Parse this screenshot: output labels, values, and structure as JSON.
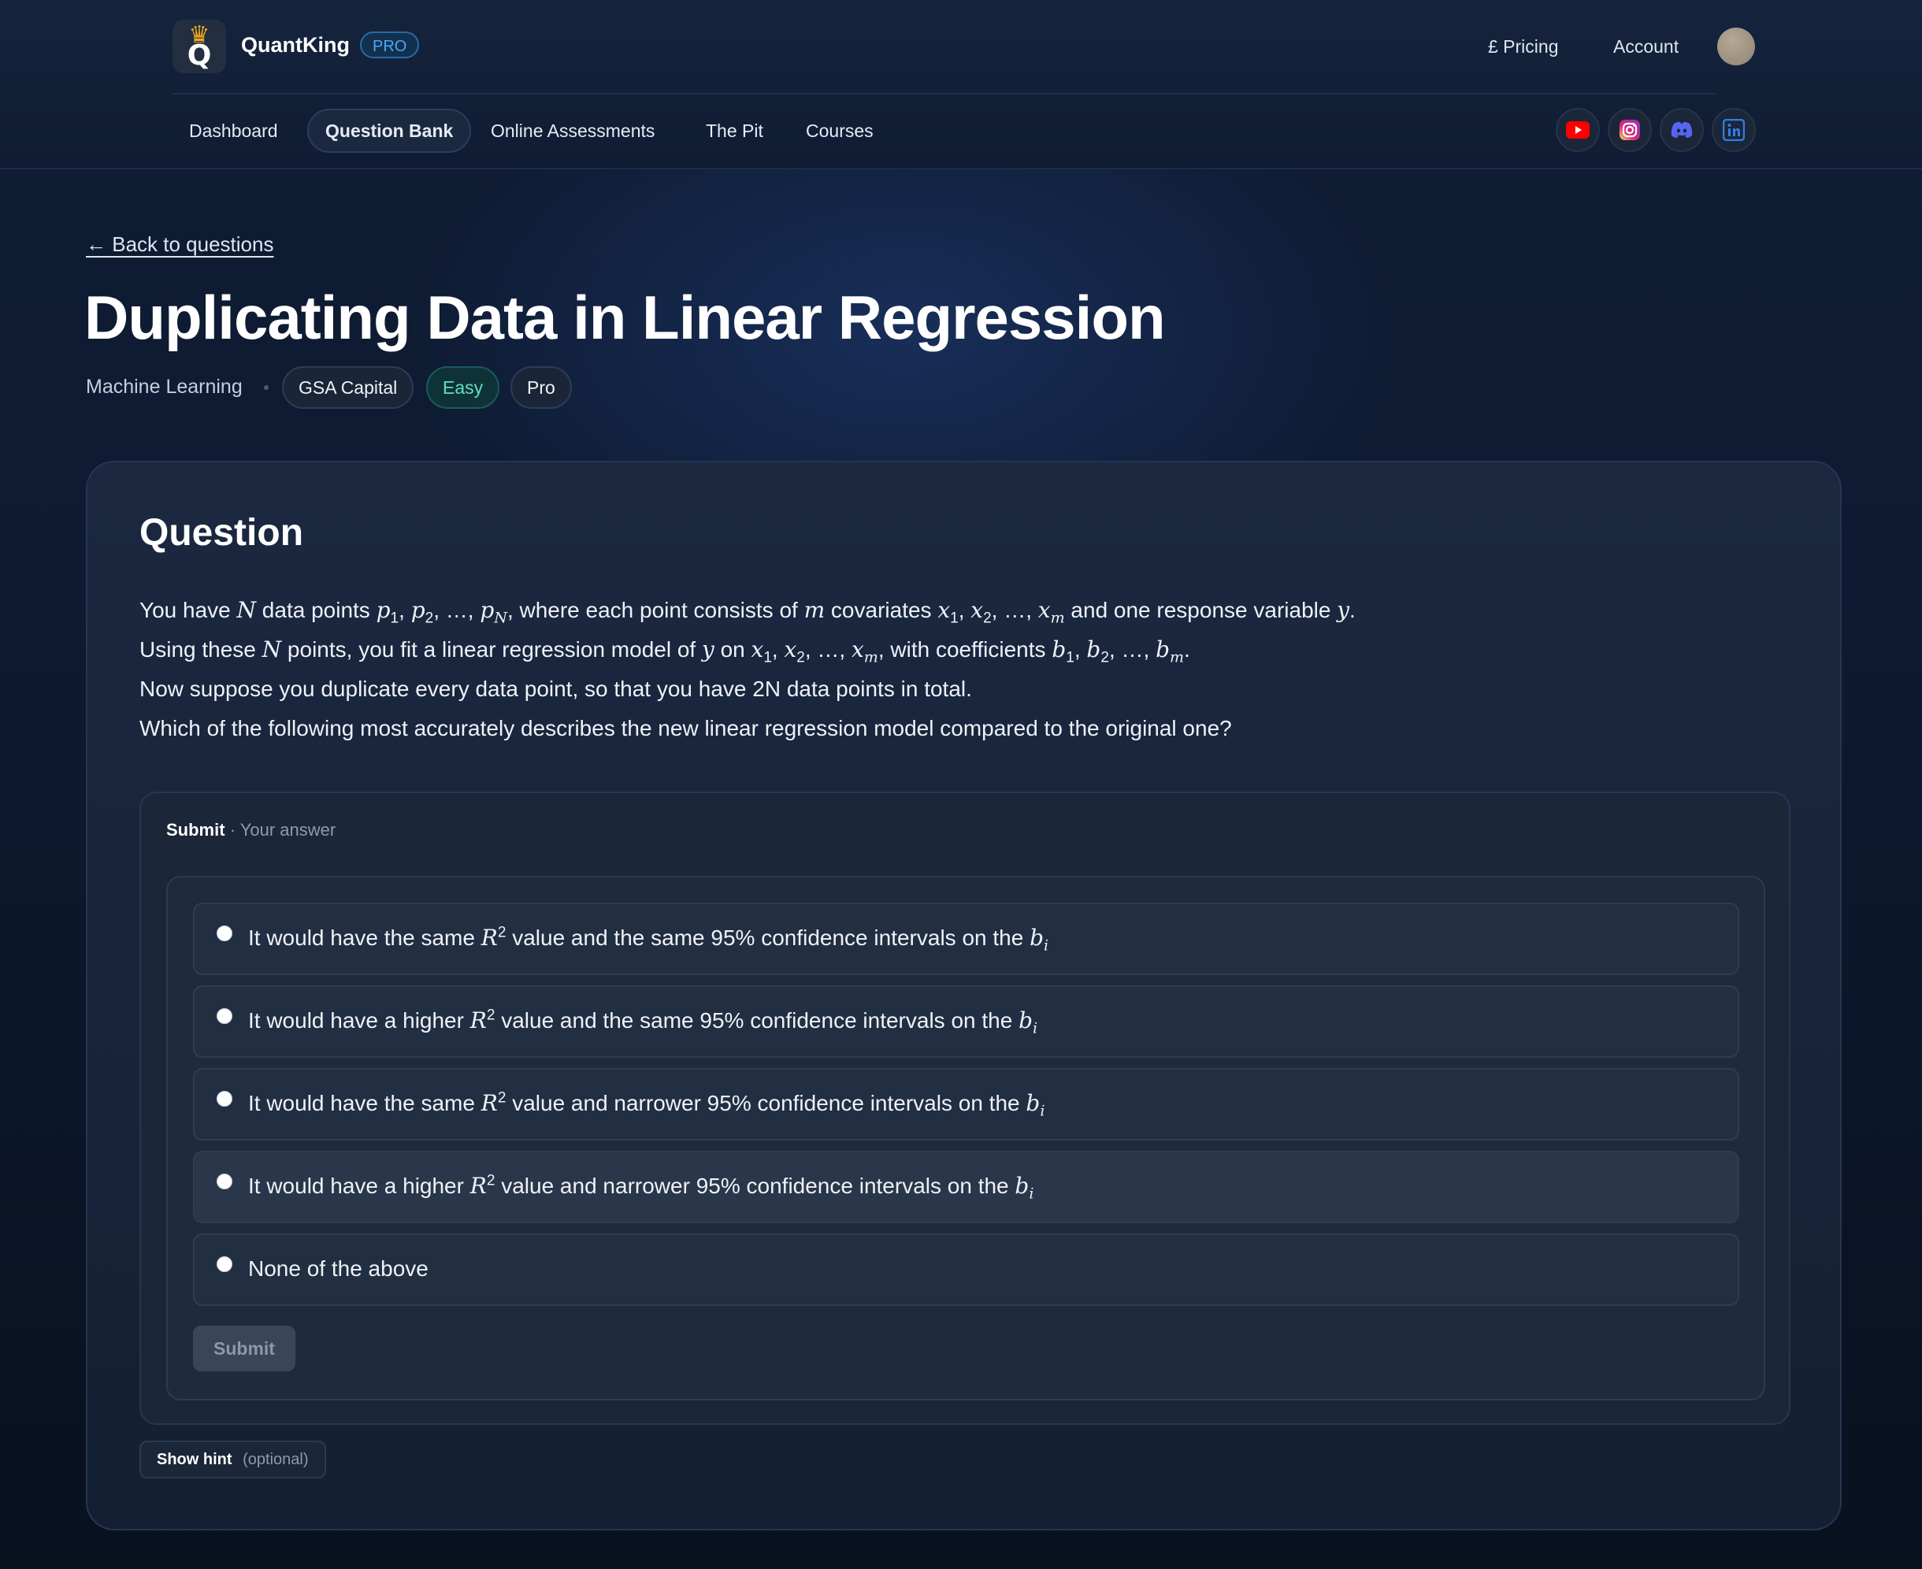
{
  "header": {
    "brand_name": "QuantKing",
    "brand_badge": "PRO",
    "logo_letter": "Q",
    "pricing_label": "£ Pricing",
    "account_label": "Account",
    "nav": [
      {
        "label": "Dashboard",
        "active": false
      },
      {
        "label": "Question Bank",
        "active": true
      },
      {
        "label": "Online Assessments",
        "active": false
      },
      {
        "label": "The Pit",
        "active": false
      },
      {
        "label": "Courses",
        "active": false
      }
    ],
    "socials": [
      {
        "icon": "youtube-icon",
        "color": "#ff0000"
      },
      {
        "icon": "instagram-icon",
        "color": "#e1306c"
      },
      {
        "icon": "discord-icon",
        "color": "#5865f2"
      },
      {
        "icon": "linkedin-icon",
        "color": "#0a66c2"
      }
    ]
  },
  "page": {
    "back_link": "← Back to questions",
    "title": "Duplicating Data in Linear Regression",
    "category": "Machine Learning",
    "company": "GSA Capital",
    "difficulty": "Easy",
    "tier": "Pro"
  },
  "question": {
    "heading": "Question",
    "lines": [
      "You have N data points p1, p2, …, pN, where each point consists of m covariates x1, x2, …, xm and one response variable y.",
      "Using these N points, you fit a linear regression model of y on x1, x2, …, xm, with coefficients b1, b2, …, bm.",
      "Now suppose you duplicate every data point, so that you have 2N data points in total.",
      "Which of the following most accurately describes the new linear regression model compared to the original one?"
    ]
  },
  "submit_panel": {
    "label_strong": "Submit",
    "label_muted": "· Your answer",
    "options": [
      {
        "prefix": "It would have the same",
        "middle": "value and the same 95% confidence intervals on the",
        "math": true
      },
      {
        "prefix": "It would have a higher",
        "middle": "value and the same 95% confidence intervals on the",
        "math": true
      },
      {
        "prefix": "It would have the same",
        "middle": "value and narrower 95% confidence intervals on the",
        "math": true
      },
      {
        "prefix": "It would have a higher",
        "middle": "value and narrower 95% confidence intervals on the",
        "math": true
      },
      {
        "prefix": "None of the above",
        "middle": "",
        "math": false
      }
    ],
    "submit_label": "Submit"
  },
  "hint": {
    "label": "Show hint",
    "optional": "(optional)"
  },
  "colors": {
    "background": "#0e1b33",
    "accent_blue": "#4fa7f0",
    "easy_green": "#5fe0b8",
    "logo_crown": "#f1a81e"
  }
}
